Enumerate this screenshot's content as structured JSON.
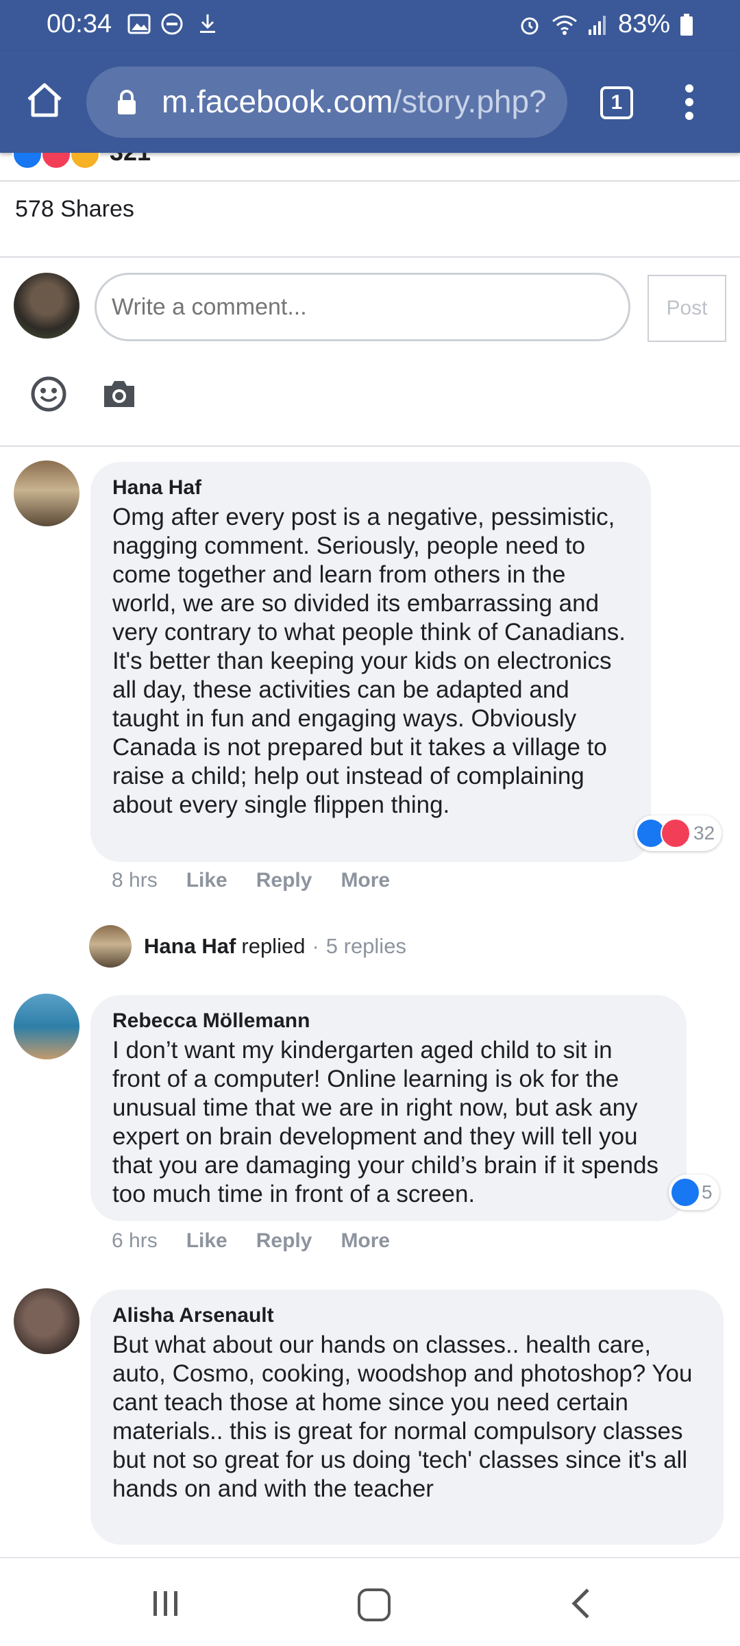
{
  "status_bar": {
    "time": "00:34",
    "battery": "83%"
  },
  "browser": {
    "url_domain": "m.facebook.com",
    "url_path": "/story.php?",
    "tab_count": "1"
  },
  "post": {
    "reaction_count": "321",
    "shares": "578 Shares"
  },
  "composer": {
    "placeholder": "Write a comment...",
    "post_label": "Post"
  },
  "comments": [
    {
      "author": "Hana Haf",
      "text": "Omg after every post is a negative, pessimistic, nagging comment. Seriously, people need to come together and learn from others in the world, we are so divided its embarrassing and very contrary to what people think of Canadians. It's better than keeping your kids on electronics all day, these activities can be adapted and taught in fun and engaging ways. Obviously Canada is not prepared but it takes a village to raise a child; help out instead of complaining about every single flippen thing.",
      "time": "8 hrs",
      "like": "Like",
      "reply": "Reply",
      "more": "More",
      "reactions": "32"
    },
    {
      "author": "Rebecca Möllemann",
      "text": "I don’t want my kindergarten aged child to sit in front of a computer! Online learning is ok for the unusual time that we are in right now, but ask any expert on brain development and they will tell you that you are damaging your child’s brain if it spends too much time in front of a screen.",
      "time": "6 hrs",
      "like": "Like",
      "reply": "Reply",
      "more": "More",
      "reactions": "5"
    },
    {
      "author": "Alisha Arsenault",
      "text": "But what about our hands on classes.. health care, auto, Cosmo, cooking, woodshop and photoshop? You cant teach those at home since you need certain materials.. this is great for normal compulsory classes but not so great for us doing 'tech' classes since it's all hands on and with the teacher"
    }
  ],
  "reply_summary": {
    "name": "Hana Haf",
    "verb": "replied",
    "separator": "·",
    "count": "5 replies"
  },
  "icons": {
    "home": "home-icon",
    "lock": "lock-icon",
    "menu": "more-vertical-icon",
    "emoji": "emoji-icon",
    "camera": "camera-icon",
    "like": "like-icon",
    "love": "love-icon"
  },
  "colors": {
    "facebook_blue": "#3b5998",
    "like_blue": "#1877f2",
    "love_red": "#f33e58",
    "bubble_bg": "#f0f2f5"
  }
}
